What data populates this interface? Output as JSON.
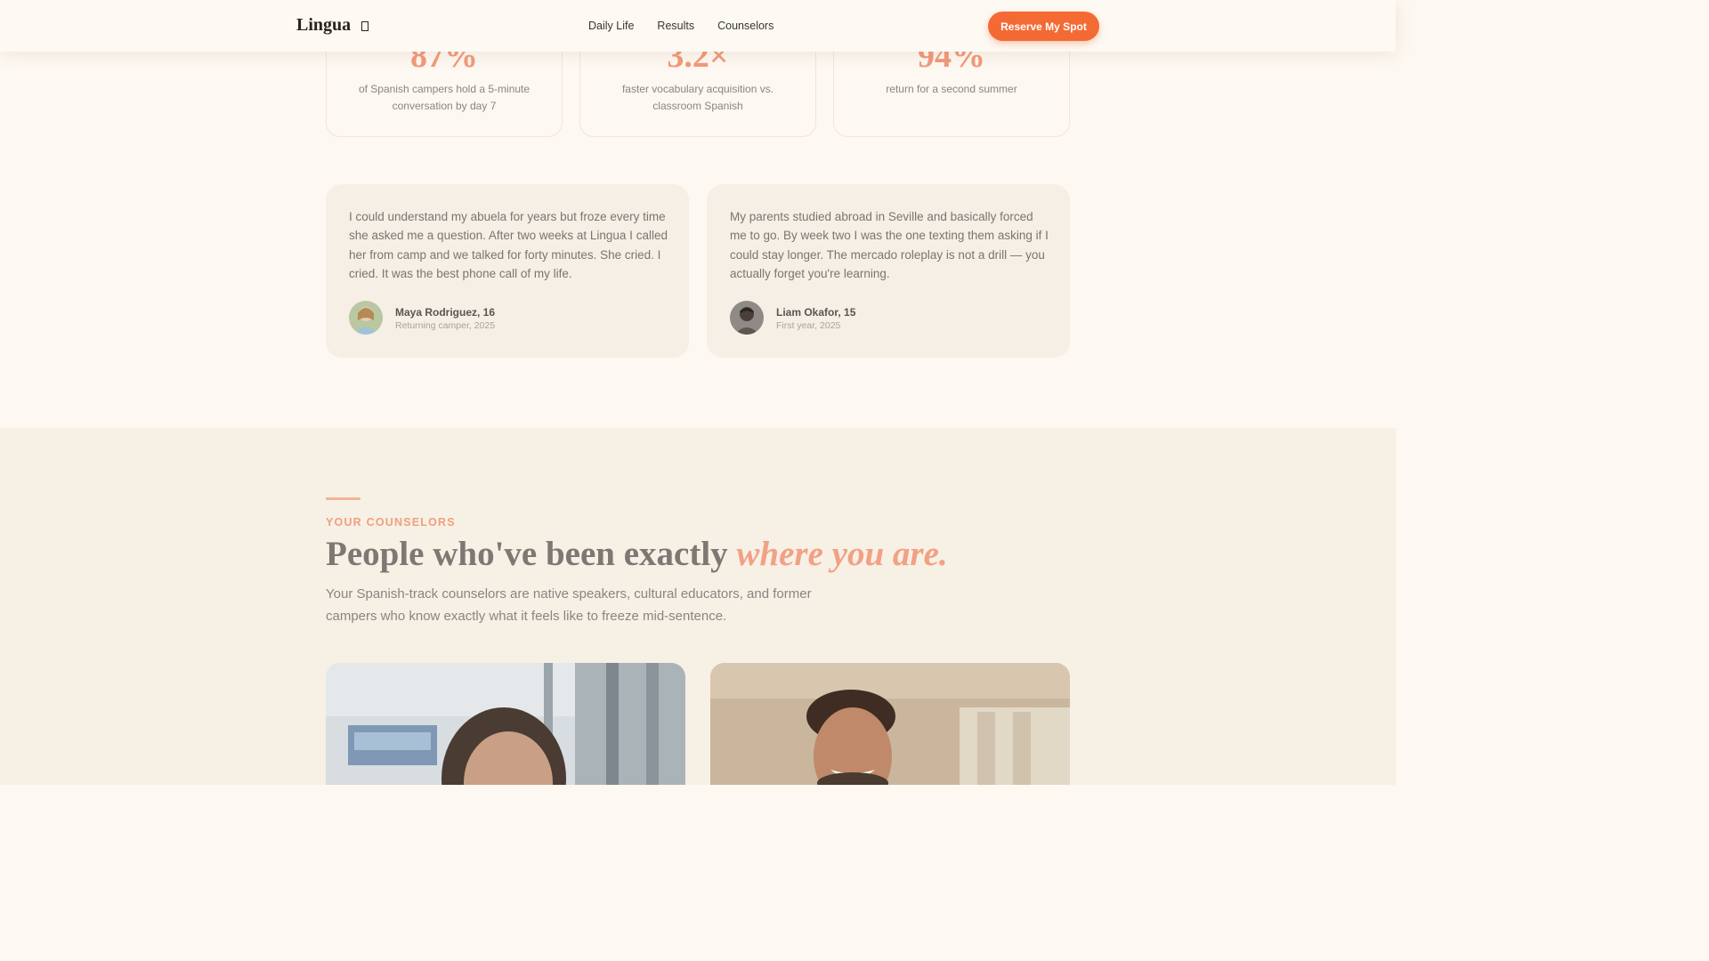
{
  "header": {
    "logo": "Lingua",
    "nav": [
      "Daily Life",
      "Results",
      "Counselors"
    ],
    "cta": "Reserve My Spot"
  },
  "stats": [
    {
      "value": "87%",
      "label": "of Spanish campers hold a 5-minute conversation by day 7"
    },
    {
      "value": "3.2×",
      "label": "faster vocabulary acquisition vs. classroom Spanish"
    },
    {
      "value": "94%",
      "label": "return for a second summer"
    }
  ],
  "testimonials": [
    {
      "quote": "I could understand my abuela for years but froze every time she asked me a question. After two weeks at Lingua I called her from camp and we talked for forty minutes. She cried. I cried. It was the best phone call of my life.",
      "name": "Maya Rodriguez, 16",
      "role": "Returning camper, 2025"
    },
    {
      "quote": "My parents studied abroad in Seville and basically forced me to go. By week two I was the one texting them asking if I could stay longer. The mercado roleplay is not a drill — you actually forget you're learning.",
      "name": "Liam Okafor, 15",
      "role": "First year, 2025"
    }
  ],
  "counselors": {
    "eyebrow": "YOUR COUNSELORS",
    "heading_plain": "People who've been exactly ",
    "heading_em": "where you are.",
    "lead": "Your Spanish-track counselors are native speakers, cultural educators, and former campers who know exactly what it feels like to freeze mid-sentence."
  },
  "colors": {
    "accent": "#f46a34",
    "stat_number": "#f29a7a",
    "background": "#fdf8f1"
  }
}
